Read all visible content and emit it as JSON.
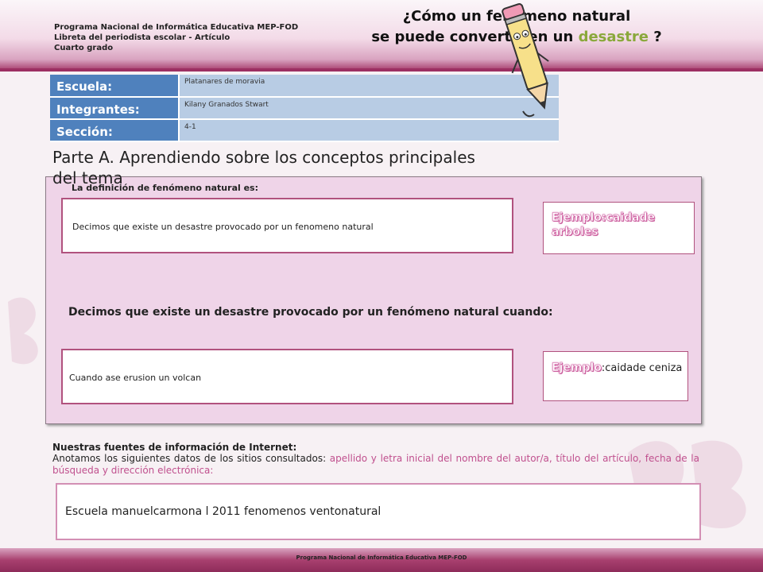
{
  "header": {
    "program_lines": [
      "Programa Nacional de Informática Educativa MEP-FOD",
      "Libreta del periodista escolar -  Artículo",
      "Cuarto grado"
    ],
    "title_line1": "¿Cómo un fenómeno natural",
    "title_line2_prefix": "se puede convertir en un",
    "title_line2_green": "desastre",
    "title_line2_suffix": " ?"
  },
  "info": {
    "rows": [
      {
        "label": "Escuela:",
        "value": "Platanares de moravia"
      },
      {
        "label": "Integrantes:",
        "value": "Kilany   Granados    Stwart"
      },
      {
        "label": "Sección:",
        "value": "4-1"
      }
    ]
  },
  "part_a_title": "Parte A.  Aprendiendo sobre los conceptos principales del tema",
  "definition": {
    "label": "La definición de  fenómeno natural es:",
    "answer": "Decimos que existe un desastre provocado por un fenomeno natural",
    "example_head": "Ejemplo:caidade arboles"
  },
  "disaster": {
    "sentence": "Decimos que existe un desastre provocado por un fenómeno natural cuando:",
    "answer": "Cuando ase erusion un volcan",
    "example_head": "Ejemplo",
    "example_text": ":caidade ceniza"
  },
  "sources": {
    "title": "Nuestras fuentes de información de Internet:",
    "intro": "Anotamos los siguientes datos de los sitios consultados: ",
    "intro_pink": "apellido y letra inicial del nombre del autor/a, título del artículo, fecha de la búsqueda y dirección electrónica:",
    "answer": "Escuela manuelcarmona l 2011 fenomenos   ventonatural"
  },
  "footer": {
    "text": "Programa  Nacional de Informática  Educativa MEP-FOD"
  },
  "colors": {
    "accent_pink": "#b1527e",
    "label_blue": "#4f81bd",
    "value_blue": "#b8cce4",
    "panel_pink": "#efd4e8",
    "title_green": "#8aa83b"
  }
}
